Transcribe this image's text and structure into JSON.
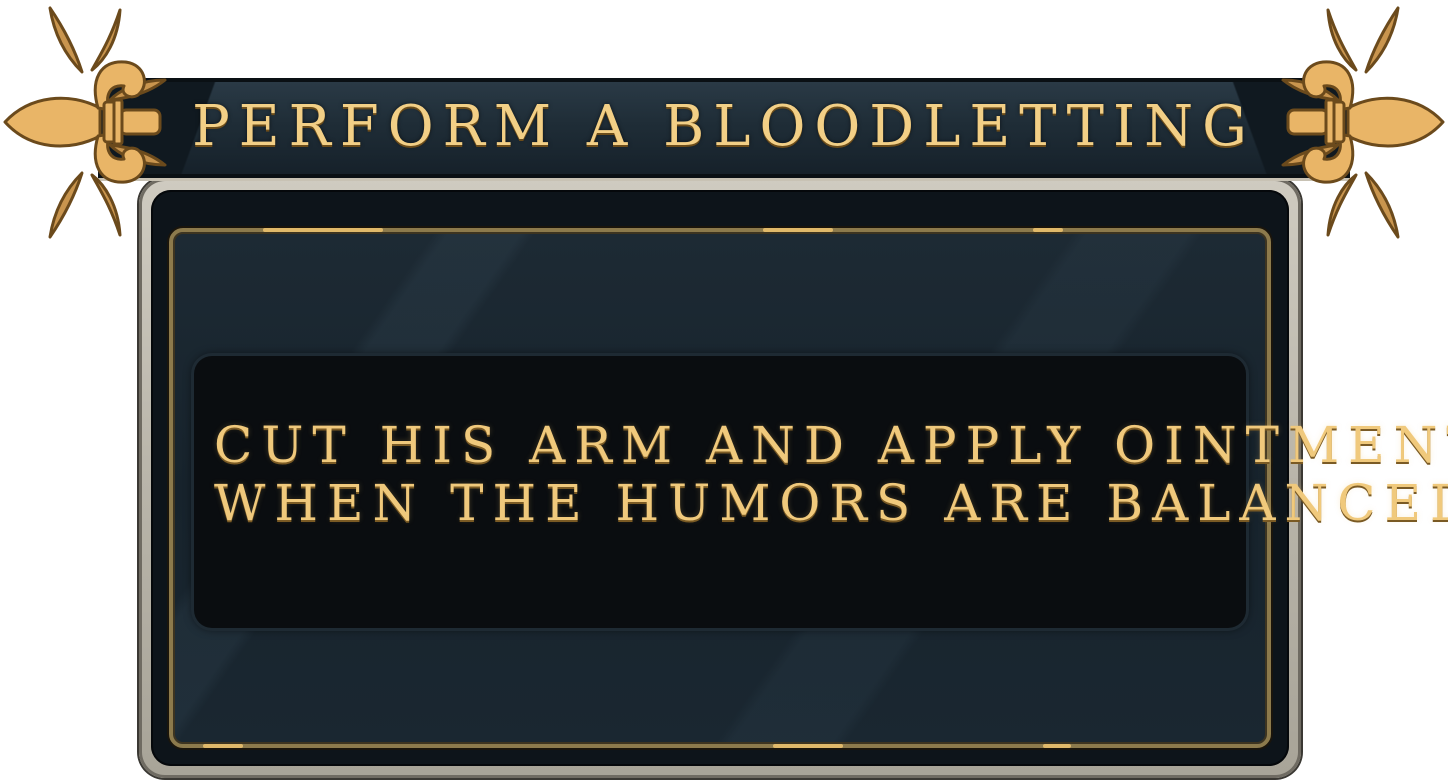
{
  "dialog": {
    "title": "PERFORM A BLOODLETTING",
    "message_lines": [
      "CUT HIS ARM AND APPLY OINTMENT",
      "WHEN THE HUMORS ARE BALANCED."
    ]
  },
  "icons": {
    "left_ornament": "fleur-de-lis-icon",
    "right_ornament": "fleur-de-lis-icon"
  },
  "colors": {
    "gold_text": "#f0c97c",
    "panel_dark": "#17232c",
    "message_bg": "#0a0d10",
    "frame_stone": "#bdb9ae",
    "ornament_gold": "#e9b567"
  }
}
